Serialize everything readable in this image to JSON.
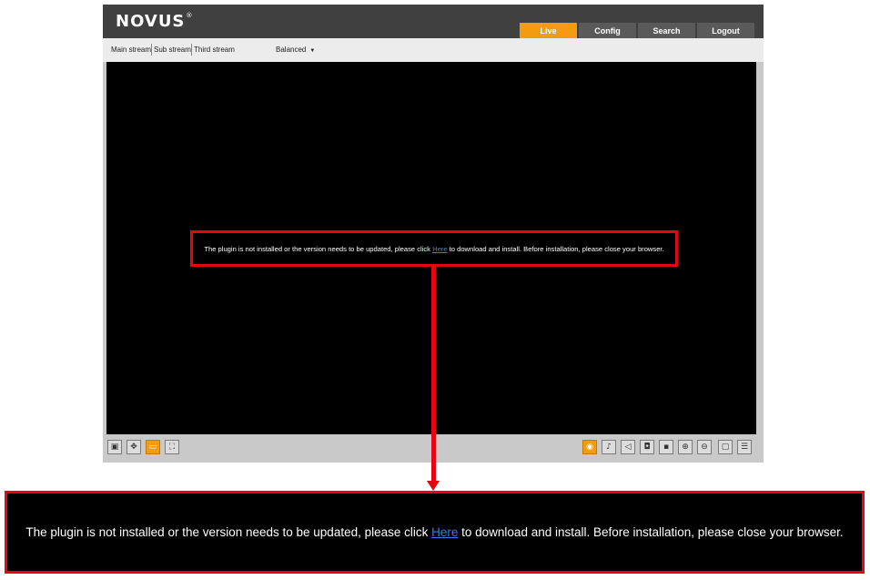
{
  "header": {
    "logo": "NOVUS",
    "logo_mark": "®",
    "nav": [
      {
        "label": "Live",
        "active": true
      },
      {
        "label": "Config",
        "active": false
      },
      {
        "label": "Search",
        "active": false
      },
      {
        "label": "Logout",
        "active": false
      }
    ]
  },
  "streambar": {
    "streams": [
      "Main stream",
      "Sub stream",
      "Third stream"
    ],
    "quality": "Balanced"
  },
  "message": {
    "before": "The plugin is not installed or the version needs to be updated, please click ",
    "link": "Here",
    "after": " to download and install. Before installation, please close your browser."
  },
  "controls": {
    "left": [
      "info-icon",
      "ptz-icon",
      "window-icon",
      "fullscreen-icon"
    ],
    "right": [
      "eye-icon",
      "microphone-icon",
      "speaker-icon",
      "snapshot-icon",
      "record-icon",
      "zoom-in-icon",
      "zoom-out-icon",
      "original-size-icon",
      "face-icon"
    ]
  },
  "colors": {
    "accent": "#f39c12",
    "highlight": "#e30613",
    "link": "#3b7de0"
  }
}
